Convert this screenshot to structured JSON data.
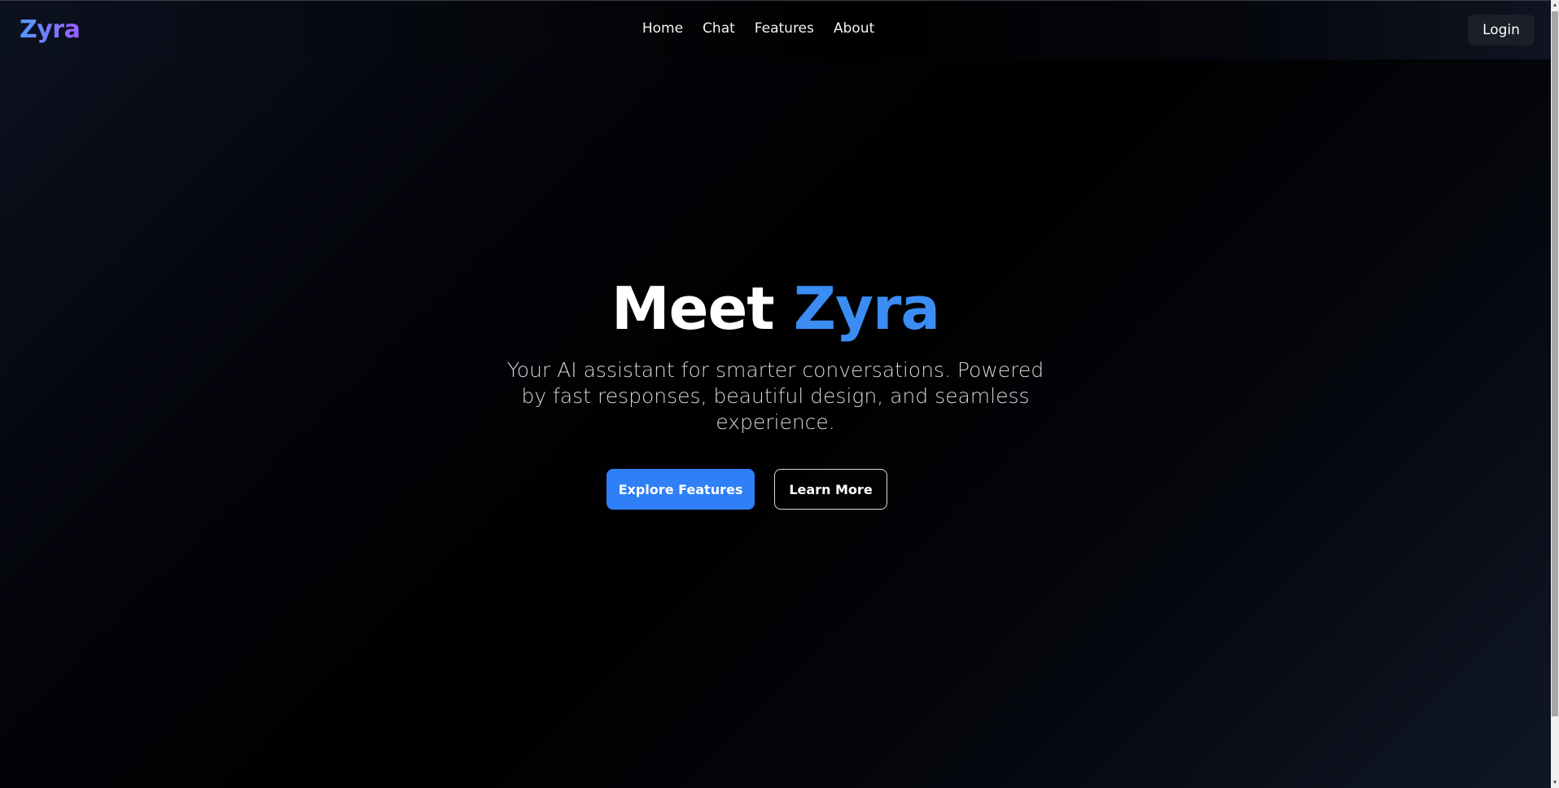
{
  "header": {
    "logo": "Zyra",
    "nav": [
      "Home",
      "Chat",
      "Features",
      "About"
    ],
    "login_label": "Login"
  },
  "hero": {
    "title_prefix": "Meet",
    "title_accent": "Zyra",
    "subtitle": "Your AI assistant for smarter conversations. Powered by fast responses, beautiful design, and seamless experience.",
    "primary_button": "Explore Features",
    "secondary_button": "Learn More"
  },
  "colors": {
    "accent": "#3b8df4",
    "primary_button": "#2f80f7",
    "logo_gradient_start": "#4f9bff",
    "logo_gradient_end": "#9d5cff",
    "background": "#000000"
  },
  "icons": {
    "scroll_up": "scroll-up-arrow-icon",
    "scroll_down": "scroll-down-arrow-icon"
  }
}
